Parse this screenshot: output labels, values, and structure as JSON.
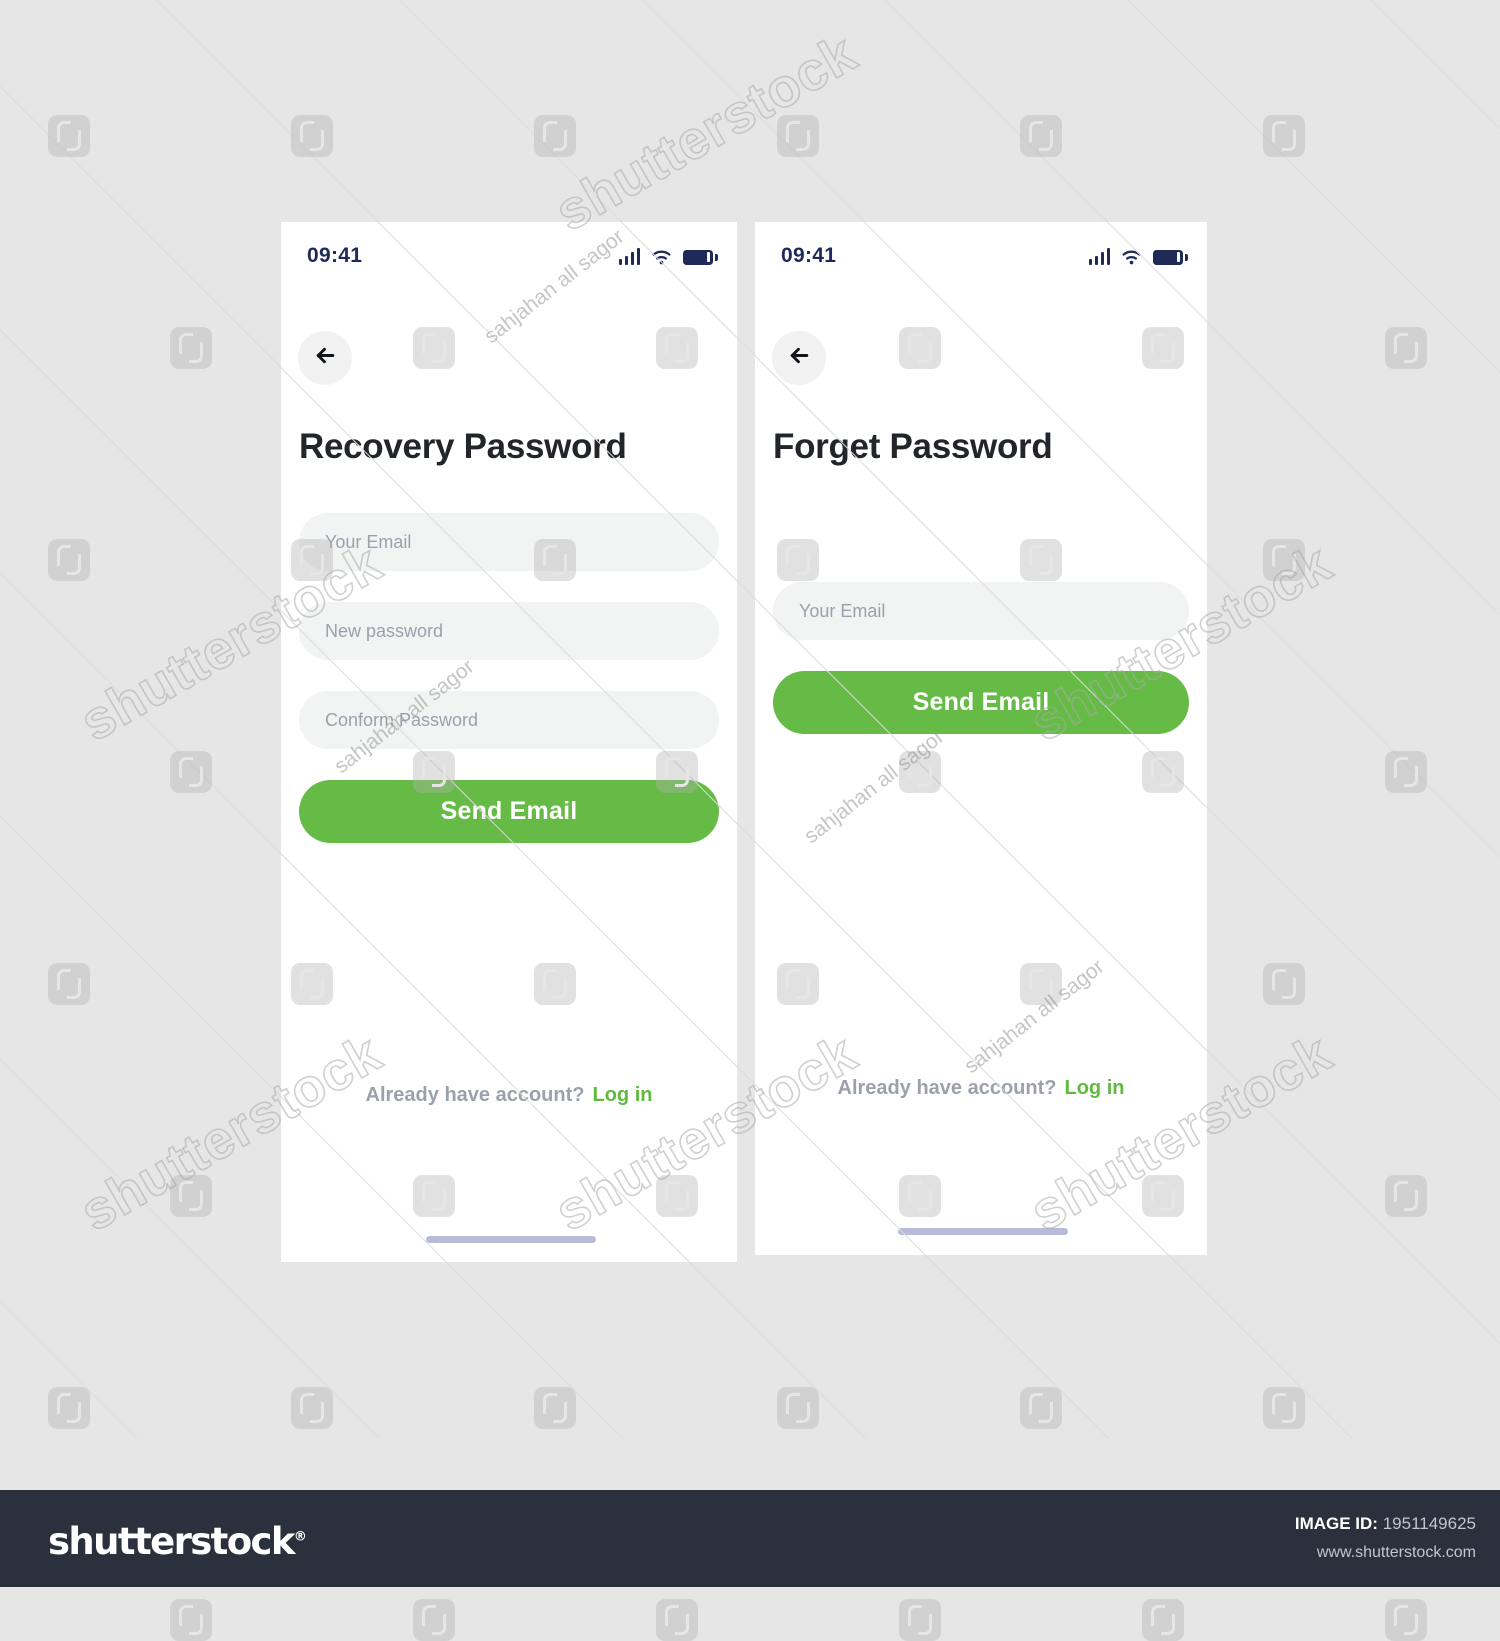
{
  "screens": [
    {
      "id": "recovery",
      "status": {
        "time": "09:41",
        "signal_icon": "signal-bars-icon",
        "wifi_icon": "wifi-icon",
        "battery_icon": "battery-icon"
      },
      "back_icon": "arrow-left-icon",
      "title": "Recovery Password",
      "fields": [
        {
          "placeholder": "Your Email",
          "name": "email-field"
        },
        {
          "placeholder": "New password",
          "name": "new-password-field"
        },
        {
          "placeholder": "Conform Password",
          "name": "confirm-password-field"
        }
      ],
      "submit_label": "Send Email",
      "footer_prompt": "Already have account?",
      "footer_link": "Log in"
    },
    {
      "id": "forget",
      "status": {
        "time": "09:41",
        "signal_icon": "signal-bars-icon",
        "wifi_icon": "wifi-icon",
        "battery_icon": "battery-icon"
      },
      "back_icon": "arrow-left-icon",
      "title": "Forget Password",
      "fields": [
        {
          "placeholder": "Your Email",
          "name": "email-field"
        }
      ],
      "submit_label": "Send Email",
      "footer_prompt": "Already have account?",
      "footer_link": "Log in"
    }
  ],
  "colors": {
    "accent_green": "#66bb46",
    "link_green": "#5fba3f",
    "status_navy": "#1f2a58",
    "title_dark": "#22262b",
    "field_bg": "#f2f3f3",
    "placeholder": "#9ba1ac",
    "page_bg": "#e6e6e6",
    "home_indicator": "#b8bcd8",
    "footer_bg": "#2b313c"
  },
  "watermark": {
    "brand_text": "shutterstock",
    "signature": "sahjahan all sagor",
    "logo_icon": "shutterstock-logo-mark"
  },
  "site_footer": {
    "logo": "shutterstock",
    "logo_mark": "®",
    "image_id_label": "IMAGE ID:",
    "image_id_value": "1951149625",
    "url": "www.shutterstock.com"
  }
}
